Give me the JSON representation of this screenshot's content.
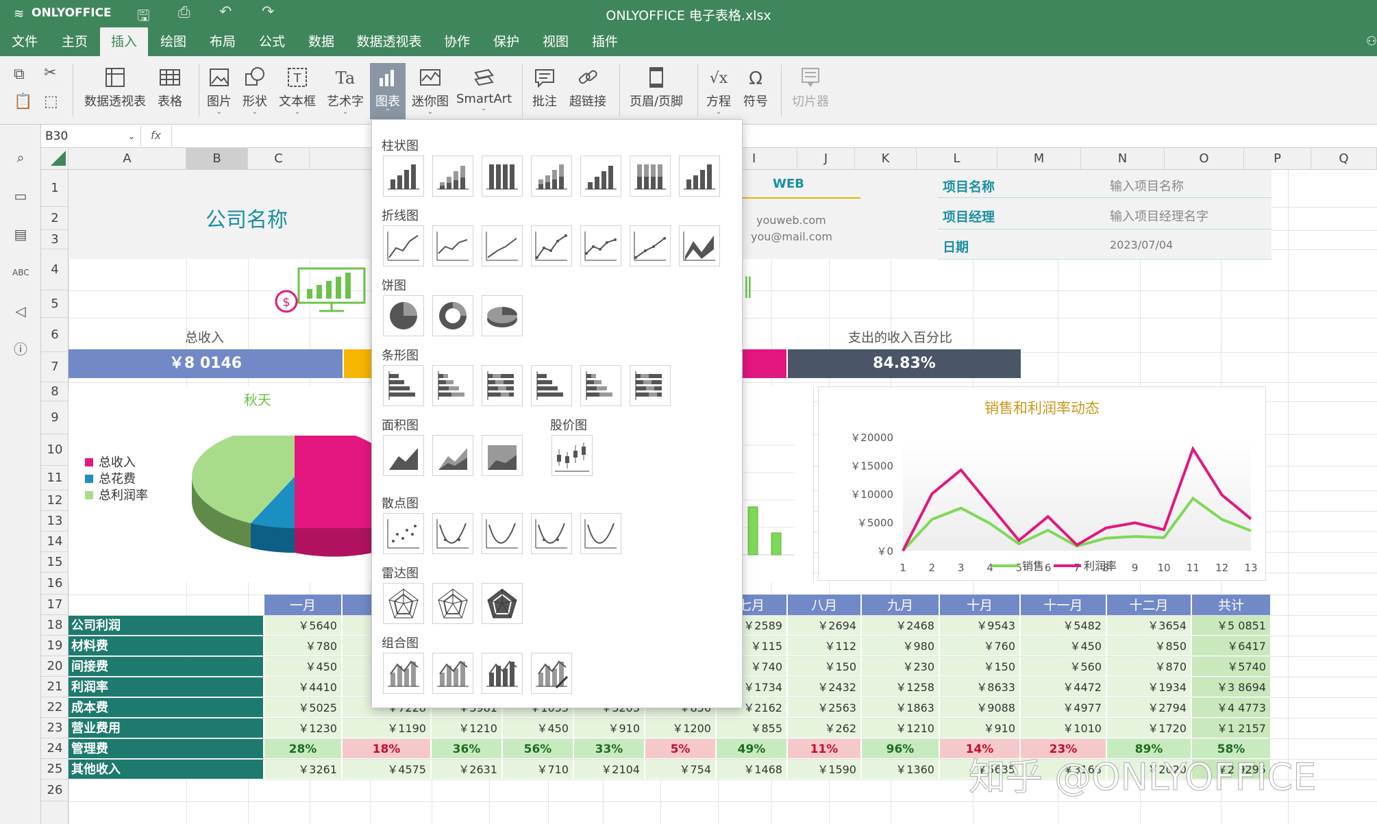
{
  "app": {
    "logo_text": "ONLYOFFICE",
    "doc_title": "ONLYOFFICE 电子表格.xlsx"
  },
  "menu": [
    "文件",
    "主页",
    "插入",
    "绘图",
    "布局",
    "公式",
    "数据",
    "数据透视表",
    "协作",
    "保护",
    "视图",
    "插件"
  ],
  "toolbar": {
    "buttons": [
      "数据透视表",
      "表格",
      "图片",
      "形状",
      "文本框",
      "艺术字",
      "图表",
      "迷你图",
      "SmartArt",
      "批注",
      "超链接",
      "页眉/页脚",
      "方程",
      "符号",
      "切片器"
    ]
  },
  "formula": {
    "cell_ref": "B30",
    "fx": "fx",
    "value": ""
  },
  "columns": [
    "A",
    "B",
    "C",
    "",
    "",
    "",
    "",
    "",
    "",
    "I",
    "J",
    "K",
    "L",
    "M",
    "N",
    "O",
    "P",
    "Q"
  ],
  "rows": [
    "1",
    "2",
    "3",
    "4",
    "5",
    "6",
    "7",
    "8",
    "9",
    "10",
    "11",
    "12",
    "13",
    "14",
    "15",
    "16",
    "17",
    "18",
    "19",
    "20",
    "21",
    "22",
    "23",
    "24",
    "25",
    "26"
  ],
  "sheet": {
    "company": "公司名称",
    "web_label": "WEB",
    "web_url": "youweb.com",
    "web_mail": "you@mail.com",
    "info": [
      {
        "label": "项目名称",
        "value": "输入项目名称"
      },
      {
        "label": "项目经理",
        "value": "输入项目经理名字"
      },
      {
        "label": "日期",
        "value": "2023/07/04"
      }
    ],
    "total_income_label": "总收入",
    "total_income": "￥8 0146",
    "pct_label": "支出的收入百分比",
    "pct_value": "84.83%",
    "pie_title": "秋天",
    "pie_legend": [
      "总收入",
      "总花费",
      "总利润率"
    ],
    "line_title": "销售和利润率动态",
    "line_legend": [
      "销售",
      "利润率"
    ],
    "watermark": "知乎 @ONLYOFFICE"
  },
  "table": {
    "headers": [
      "一月",
      "",
      "",
      "",
      "",
      "",
      "七月",
      "八月",
      "九月",
      "十月",
      "十一月",
      "十二月",
      "共计"
    ],
    "rows": [
      {
        "label": "公司利润",
        "c": [
          "￥5640",
          "",
          "",
          "",
          "",
          "",
          "￥2589",
          "￥2694",
          "￥2468",
          "￥9543",
          "￥5482",
          "￥3654"
        ],
        "total": "￥5 0851"
      },
      {
        "label": "材料费",
        "c": [
          "￥780",
          "",
          "",
          "",
          "",
          "",
          "￥115",
          "￥112",
          "￥980",
          "￥760",
          "￥450",
          "￥850"
        ],
        "total": "￥6417"
      },
      {
        "label": "间接费",
        "c": [
          "￥450",
          "",
          "",
          "",
          "",
          "",
          "￥740",
          "￥150",
          "￥230",
          "￥150",
          "￥560",
          "￥870"
        ],
        "total": "￥5740"
      },
      {
        "label": "利润率",
        "c": [
          "￥4410",
          "",
          "",
          "",
          "",
          "",
          "￥1734",
          "￥2432",
          "￥1258",
          "￥8633",
          "￥4472",
          "￥1934"
        ],
        "total": "￥3 8694"
      },
      {
        "label": "成本费",
        "c": [
          "￥5025",
          "￥7228",
          "￥3981",
          "￥1033",
          "￥3203",
          "￥856",
          "￥2162",
          "￥2563",
          "￥1863",
          "￥9088",
          "￥4977",
          "￥2794"
        ],
        "total": "￥4 4773"
      },
      {
        "label": "营业费用",
        "c": [
          "￥1230",
          "￥1190",
          "￥1210",
          "￥450",
          "￥910",
          "￥1200",
          "￥855",
          "￥262",
          "￥1210",
          "￥910",
          "￥1010",
          "￥1720"
        ],
        "total": "￥1 2157"
      },
      {
        "label": "管理费",
        "c": [
          "28%",
          "18%",
          "36%",
          "56%",
          "33%",
          "5%",
          "49%",
          "11%",
          "96%",
          "14%",
          "23%",
          "89%"
        ],
        "total": "58%"
      },
      {
        "label": "其他收入",
        "c": [
          "￥3261",
          "￥4575",
          "￥2631",
          "￥710",
          "￥2104",
          "￥754",
          "￥1468",
          "￥1590",
          "￥1360",
          "￥5635",
          "￥3168",
          "￥2020"
        ],
        "total": "￥2 9295"
      }
    ]
  },
  "chart_menu": {
    "sections": [
      "柱状图",
      "折线图",
      "饼图",
      "条形图",
      "面积图",
      "股价图",
      "散点图",
      "雷达图",
      "组合图"
    ]
  },
  "chart_data": {
    "type": "line",
    "title": "销售和利润率动态",
    "x": [
      1,
      2,
      3,
      4,
      5,
      6,
      7,
      8,
      9,
      10,
      11,
      13
    ],
    "categories": [
      "1",
      "2",
      "3",
      "4",
      "5",
      "6",
      "7",
      "8",
      "9",
      "10",
      "11",
      "12",
      "13"
    ],
    "series": [
      {
        "name": "销售",
        "color": "#7ed957",
        "values": [
          0,
          5500,
          7500,
          4800,
          1200,
          3600,
          800,
          2200,
          2500,
          2300,
          9200,
          5500,
          3500
        ]
      },
      {
        "name": "利润率",
        "color": "#e3177f",
        "values": [
          0,
          10000,
          14200,
          8000,
          1800,
          6000,
          1000,
          4000,
          4900,
          3700,
          17900,
          9800,
          5600
        ]
      }
    ],
    "yticks": [
      "￥20000",
      "￥15000",
      "￥10000",
      "￥5000",
      "￥0"
    ],
    "ylim": [
      0,
      20000
    ]
  }
}
